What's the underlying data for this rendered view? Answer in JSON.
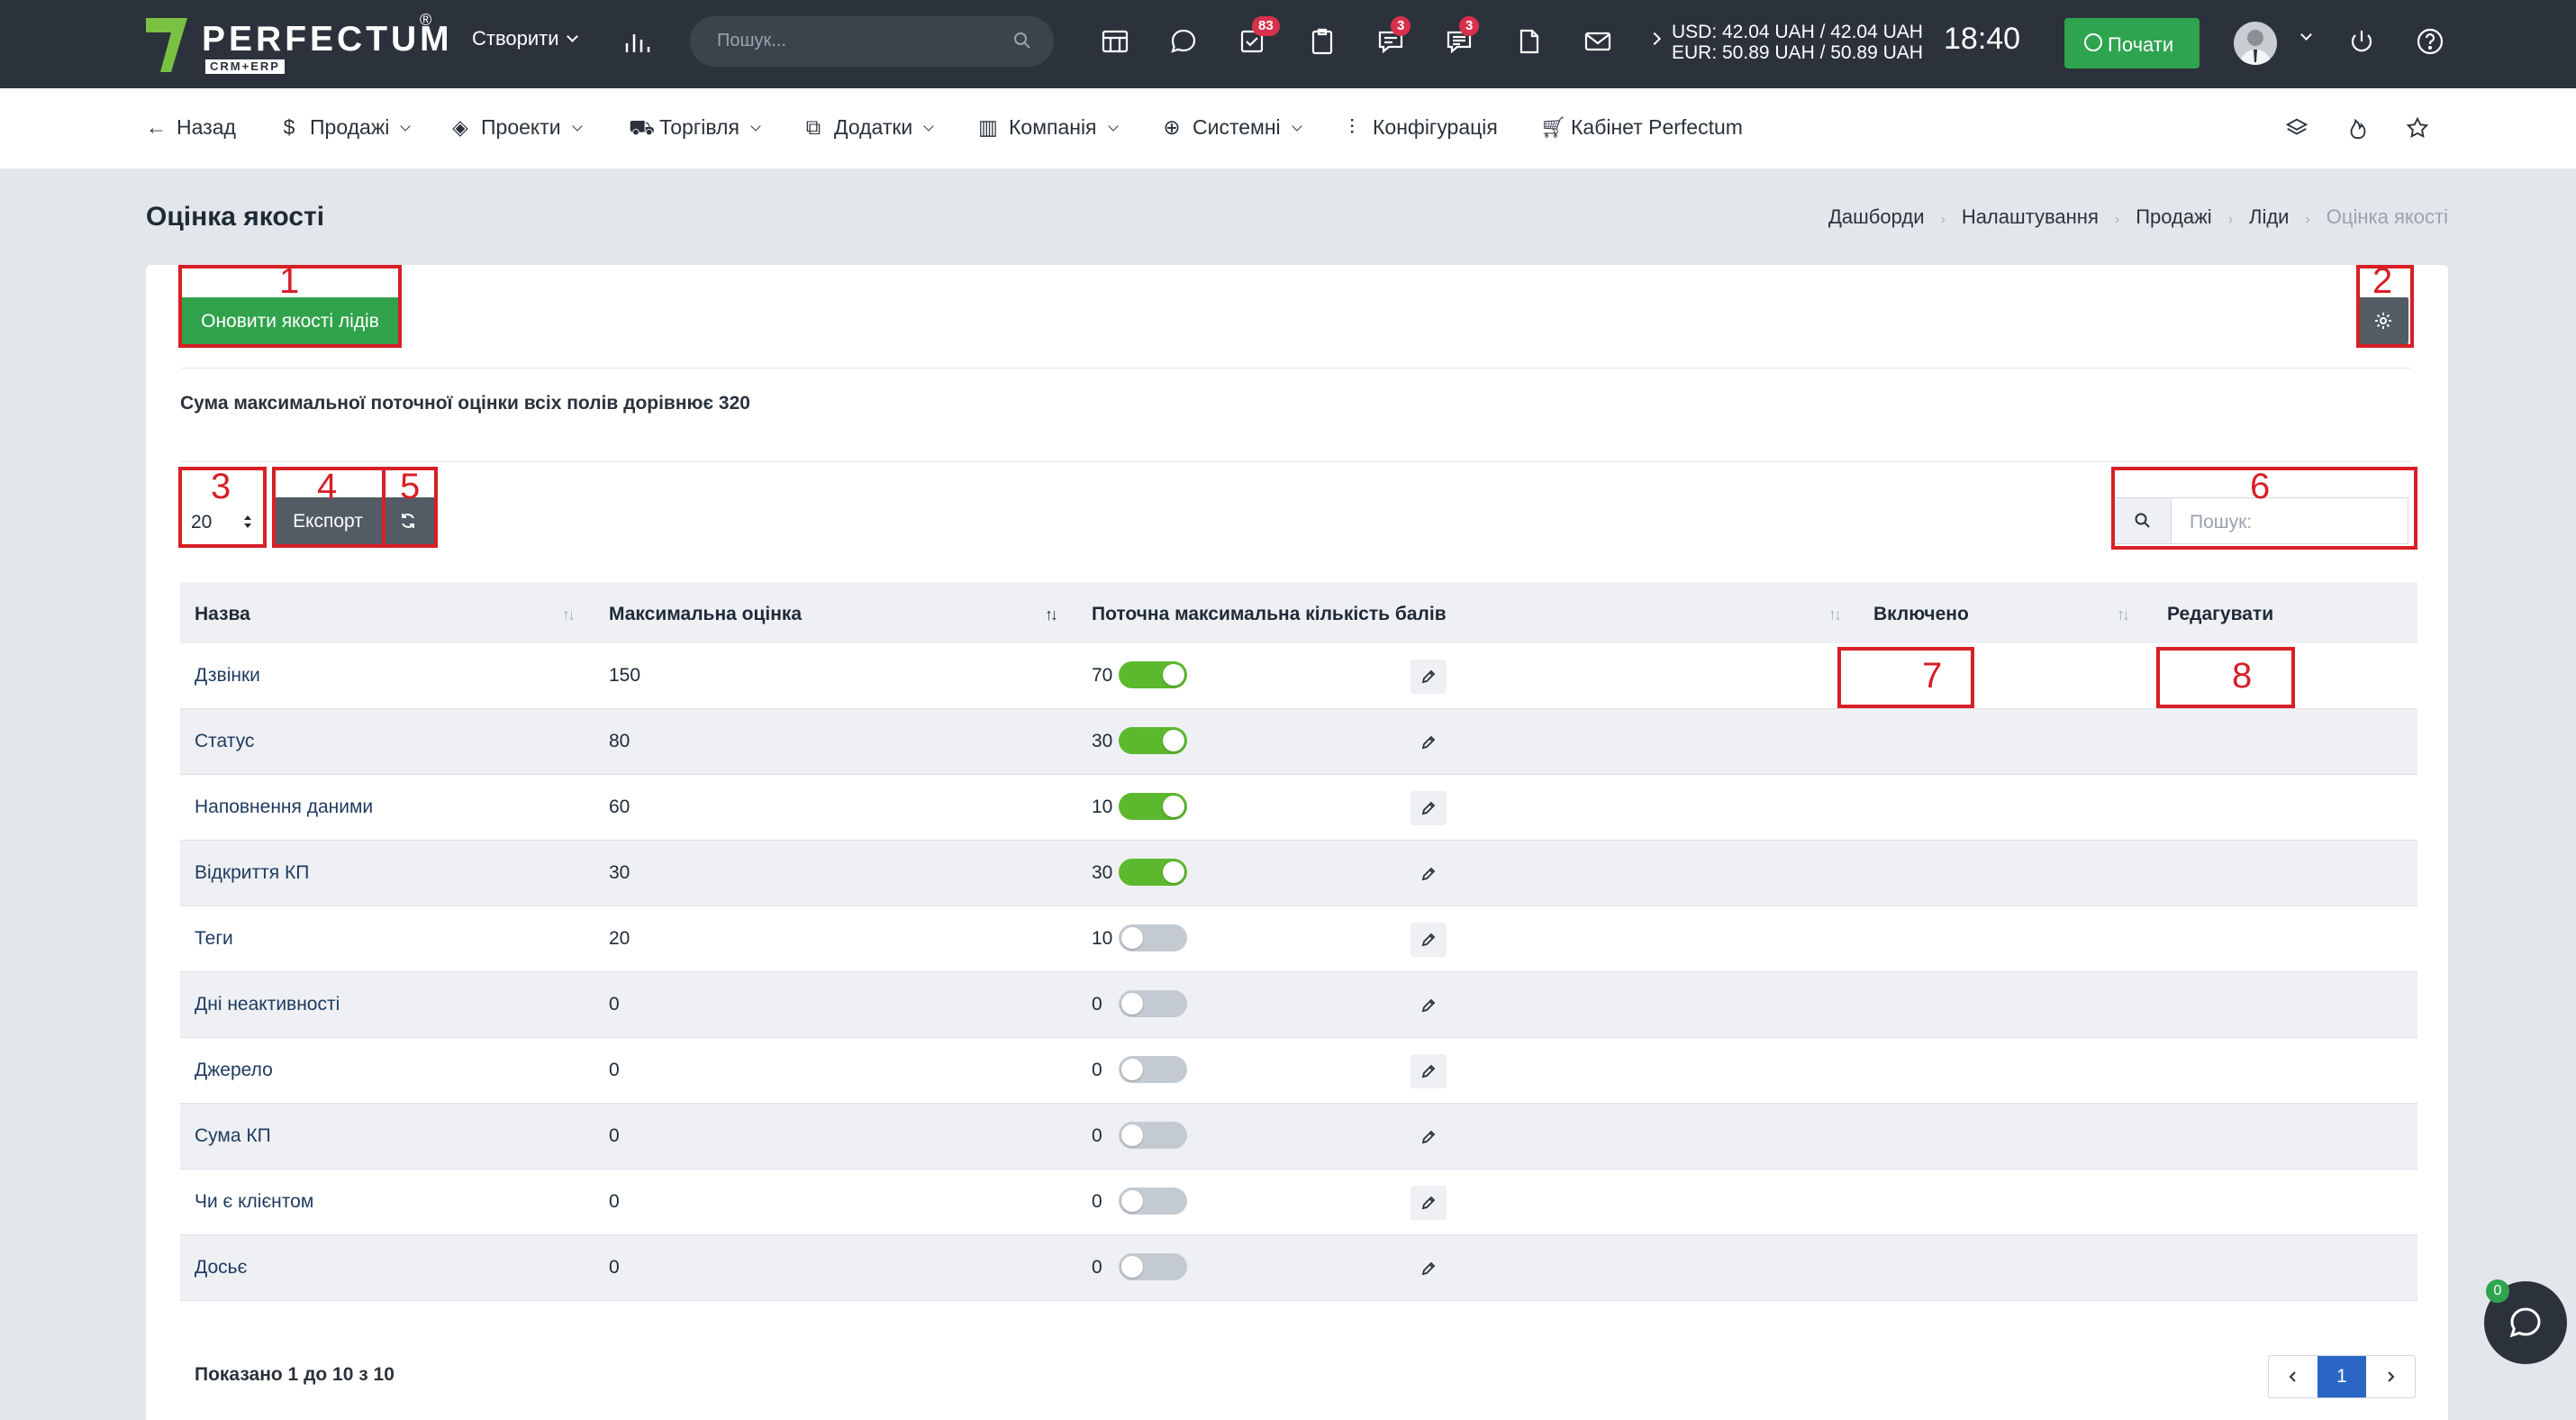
{
  "topbar": {
    "brand": "PERFECTUM",
    "brand_reg": "®",
    "brand_sub": "CRM+ERP",
    "create_label": "Створити",
    "search_placeholder": "Пошук...",
    "badges": {
      "tasks": "83",
      "chat": "3",
      "messages": "3"
    },
    "rates": {
      "usd": "USD: 42.04 UAH / 42.04 UAH",
      "eur": "EUR: 50.89 UAH / 50.89 UAH"
    },
    "clock": "18:40",
    "start_label": "Почати"
  },
  "menu": {
    "back": "Назад",
    "sales": "Продажі",
    "projects": "Проекти",
    "trade": "Торгівля",
    "addons": "Додатки",
    "company": "Компанія",
    "system": "Системні",
    "config": "Конфігурація",
    "cabinet": "Кабінет Perfectum"
  },
  "page": {
    "title": "Оцінка якості",
    "breadcrumb": [
      "Дашборди",
      "Налаштування",
      "Продажі",
      "Ліди",
      "Оцінка якості"
    ]
  },
  "toolbar": {
    "update_label": "Оновити якості лідів",
    "sum_text": "Сума максимальної поточної оцінки всіх полів дорівнює 320",
    "page_size": "20",
    "export_label": "Експорт",
    "search_placeholder": "Пошук:"
  },
  "annotations": [
    "1",
    "2",
    "3",
    "4",
    "5",
    "6",
    "7",
    "8"
  ],
  "table": {
    "headers": [
      "Назва",
      "Максимальна оцінка",
      "Поточна максимальна кількість балів",
      "Включено",
      "Редагувати"
    ],
    "rows": [
      {
        "name": "Дзвінки",
        "max": "150",
        "current": "70",
        "enabled": true
      },
      {
        "name": "Статус",
        "max": "80",
        "current": "30",
        "enabled": true
      },
      {
        "name": "Наповнення даними",
        "max": "60",
        "current": "10",
        "enabled": true
      },
      {
        "name": "Відкриття КП",
        "max": "30",
        "current": "30",
        "enabled": true
      },
      {
        "name": "Теги",
        "max": "20",
        "current": "10",
        "enabled": false
      },
      {
        "name": "Дні неактивності",
        "max": "0",
        "current": "0",
        "enabled": false
      },
      {
        "name": "Джерело",
        "max": "0",
        "current": "0",
        "enabled": false
      },
      {
        "name": "Сума КП",
        "max": "0",
        "current": "0",
        "enabled": false
      },
      {
        "name": "Чи є клієнтом",
        "max": "0",
        "current": "0",
        "enabled": false
      },
      {
        "name": "Досьє",
        "max": "0",
        "current": "0",
        "enabled": false
      }
    ]
  },
  "footer": {
    "info": "Показано 1 до 10 з 10",
    "current_page": "1"
  },
  "chat_badge": "0",
  "colors": {
    "topbar": "#2b323b",
    "green": "#31a24c",
    "toggle_on": "#5cb82d",
    "annotation": "#d81f26",
    "page_active": "#2a66c4"
  }
}
